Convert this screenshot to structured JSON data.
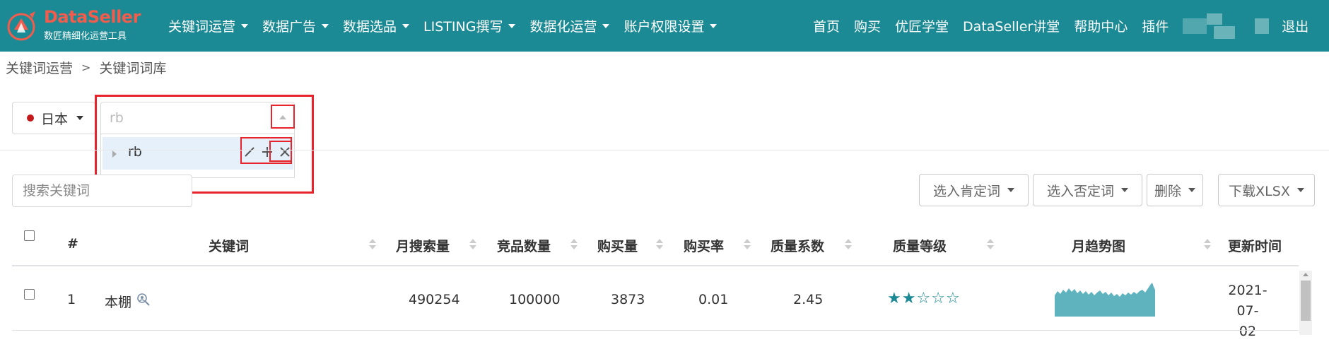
{
  "brand": {
    "name": "DataSeller",
    "tagline": "数匠精细化运营工具",
    "logo_color": "#f25c4d"
  },
  "nav": {
    "menu": [
      "关键词运营",
      "数据广告",
      "数据选品",
      "LISTING撰写",
      "数据化运营",
      "账户权限设置"
    ],
    "links": [
      "首页",
      "购买",
      "优匠学堂",
      "DataSeller讲堂",
      "帮助中心",
      "插件"
    ],
    "logout": "退出",
    "background": "#1b8a94"
  },
  "breadcrumb": {
    "parent": "关键词运营",
    "separator": ">",
    "current": "关键词词库"
  },
  "country": {
    "label": "日本",
    "dot_color": "#c21a1a"
  },
  "tag_select": {
    "placeholder": "rb",
    "options": [
      {
        "label": "rb",
        "actions": [
          "edit-icon",
          "add-icon",
          "close-icon"
        ]
      }
    ]
  },
  "search": {
    "placeholder": "搜索关键词"
  },
  "toolbar": {
    "positive": "选入肯定词",
    "negative": "选入否定词",
    "delete": "删除",
    "download": "下载XLSX"
  },
  "table": {
    "columns": [
      "#",
      "关键词",
      "月搜索量",
      "竞品数量",
      "购买量",
      "购买率",
      "质量系数",
      "质量等级",
      "月趋势图",
      "更新时间"
    ],
    "rows": [
      {
        "index": "1",
        "keyword": "本棚",
        "monthly_search": "490254",
        "competitors": "100000",
        "purchases": "3873",
        "purchase_rate": "0.01",
        "quality_coef": "2.45",
        "quality_level": 2,
        "quality_max": 5,
        "updated_line1": "2021-07-",
        "updated_line2": "02"
      }
    ]
  },
  "highlight_color": "#e8232c"
}
